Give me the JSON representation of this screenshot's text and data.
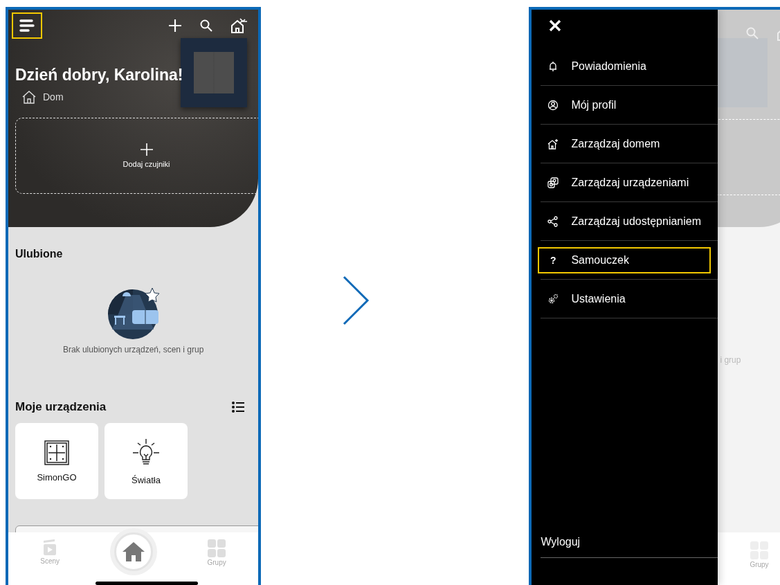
{
  "home_screen": {
    "menu_button": {
      "highlighted": true
    },
    "greeting": "Dzień dobry, Karolina!",
    "home_name": "Dom",
    "add_sensors_label": "Dodaj czujniki",
    "favorites": {
      "title": "Ulubione",
      "empty_text": "Brak ulubionych urządzeń, scen i grup"
    },
    "devices": {
      "title": "Moje urządzenia",
      "tiles": [
        {
          "label": "SimonGO",
          "kind": "switch"
        },
        {
          "label": "Światła",
          "kind": "bulb"
        }
      ]
    },
    "bottom_nav": [
      {
        "label": "Sceny",
        "kind": "scenes",
        "selected": false
      },
      {
        "kind": "home",
        "selected": true
      },
      {
        "label": "Grupy",
        "kind": "groups",
        "selected": false
      }
    ]
  },
  "menu_screen": {
    "items": [
      {
        "label": "Powiadomienia",
        "kind": "bell",
        "highlighted": false
      },
      {
        "label": "Mój profil",
        "kind": "profile",
        "highlighted": false
      },
      {
        "label": "Zarządzaj domem",
        "kind": "home",
        "highlighted": false
      },
      {
        "label": "Zarządzaj urządzeniami",
        "kind": "devices",
        "highlighted": false
      },
      {
        "label": "Zarządzaj udostępnianiem",
        "kind": "share",
        "highlighted": false
      },
      {
        "label": "Samouczek",
        "kind": "help",
        "glyph": "?",
        "highlighted": true
      },
      {
        "label": "Ustawienia",
        "kind": "settings",
        "highlighted": false
      }
    ],
    "logout": "Wyloguj",
    "background": {
      "partial_text": "i grup",
      "nav_label": "Grupy"
    }
  }
}
